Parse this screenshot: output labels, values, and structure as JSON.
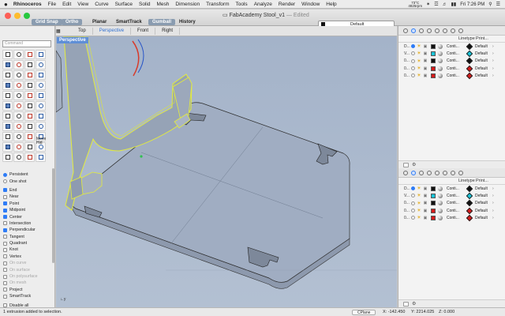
{
  "menubar": {
    "apple": "",
    "menus": [
      "Rhinoceros",
      "File",
      "Edit",
      "View",
      "Curve",
      "Surface",
      "Solid",
      "Mesh",
      "Dimension",
      "Transform",
      "Tools",
      "Analyze",
      "Render",
      "Window",
      "Help"
    ],
    "temp": "73°C",
    "rpm": "4825rpm",
    "clock": "Fri 7:26 PM"
  },
  "titlebar": {
    "title": "FabAcademy Stool_v1",
    "edited": "— Edited",
    "toggles": [
      {
        "label": "Grid Snap",
        "on": true
      },
      {
        "label": "Ortho",
        "on": true
      },
      {
        "label": "Planar",
        "on": false
      },
      {
        "label": "SmartTrack",
        "on": false
      },
      {
        "label": "Gumball",
        "on": true
      },
      {
        "label": "History",
        "on": false
      }
    ],
    "layer_select": "Default"
  },
  "left_panel": {
    "command_placeholder": "Command",
    "move_label": "Move",
    "move_sub": "Hid",
    "osnaps": [
      {
        "label": "Persistent",
        "kind": "radio",
        "on": true
      },
      {
        "label": "One shot",
        "kind": "radio",
        "on": false
      },
      {
        "kind": "gap"
      },
      {
        "label": "End",
        "kind": "check",
        "on": true
      },
      {
        "label": "Near",
        "kind": "check",
        "on": false
      },
      {
        "label": "Point",
        "kind": "check",
        "on": true
      },
      {
        "label": "Midpoint",
        "kind": "check",
        "on": true
      },
      {
        "label": "Center",
        "kind": "check",
        "on": true
      },
      {
        "label": "Intersection",
        "kind": "check",
        "on": false
      },
      {
        "label": "Perpendicular",
        "kind": "check",
        "on": true
      },
      {
        "label": "Tangent",
        "kind": "check",
        "on": false
      },
      {
        "label": "Quadrant",
        "kind": "check",
        "on": false
      },
      {
        "label": "Knot",
        "kind": "check",
        "on": false
      },
      {
        "label": "Vertex",
        "kind": "check",
        "on": false
      },
      {
        "label": "On curve",
        "kind": "check",
        "on": false,
        "disabled": true
      },
      {
        "label": "On surface",
        "kind": "check",
        "on": false,
        "disabled": true
      },
      {
        "label": "On polysurface",
        "kind": "check",
        "on": false,
        "disabled": true
      },
      {
        "label": "On mesh",
        "kind": "check",
        "on": false,
        "disabled": true
      },
      {
        "label": "Project",
        "kind": "check",
        "on": false
      },
      {
        "label": "SmartTrack",
        "kind": "check",
        "on": false
      },
      {
        "kind": "gap"
      },
      {
        "label": "Disable all",
        "kind": "check",
        "on": false
      }
    ]
  },
  "viewport": {
    "tabs": [
      "Top",
      "Perspective",
      "Front",
      "Right"
    ],
    "active_tab": "Perspective",
    "label": "Perspective",
    "axis_label": "y"
  },
  "layers_panel": {
    "headers": {
      "name": "",
      "linetype": "Linetype",
      "print": "Print..."
    },
    "rows": [
      {
        "name": "D...",
        "current": true,
        "color": "#111111",
        "linetype": "Conti...",
        "print": "Default"
      },
      {
        "name": "V...",
        "current": false,
        "color": "#19c4d8",
        "linetype": "Conti...",
        "print": "Default"
      },
      {
        "name": "0...",
        "current": false,
        "color": "#111111",
        "linetype": "Conti...",
        "print": "Default"
      },
      {
        "name": "0...",
        "current": false,
        "color": "#d41b1b",
        "linetype": "Conti...",
        "print": "Default"
      },
      {
        "name": "0...",
        "current": false,
        "color": "#d41b1b",
        "linetype": "Conti...",
        "print": "Default"
      }
    ]
  },
  "layers_panel_2": {
    "headers": {
      "name": "",
      "linetype": "Linetype",
      "print": "Print..."
    },
    "rows": [
      {
        "name": "D...",
        "current": true,
        "color": "#111111",
        "linetype": "Conti...",
        "print": "Default"
      },
      {
        "name": "V...",
        "current": false,
        "color": "#19c4d8",
        "linetype": "Conti...",
        "print": "Default"
      },
      {
        "name": "0...",
        "current": false,
        "color": "#111111",
        "linetype": "Conti...",
        "print": "Default"
      },
      {
        "name": "0...",
        "current": false,
        "color": "#d41b1b",
        "linetype": "Conti...",
        "print": "Default"
      },
      {
        "name": "0...",
        "current": false,
        "color": "#d41b1b",
        "linetype": "Conti...",
        "print": "Default"
      }
    ]
  },
  "statusbar": {
    "message": "1 extrusion added to selection.",
    "cplane": "CPlane",
    "x": "X: -142.450",
    "y": "Y: 2214.025",
    "z": "Z: 0.000"
  }
}
